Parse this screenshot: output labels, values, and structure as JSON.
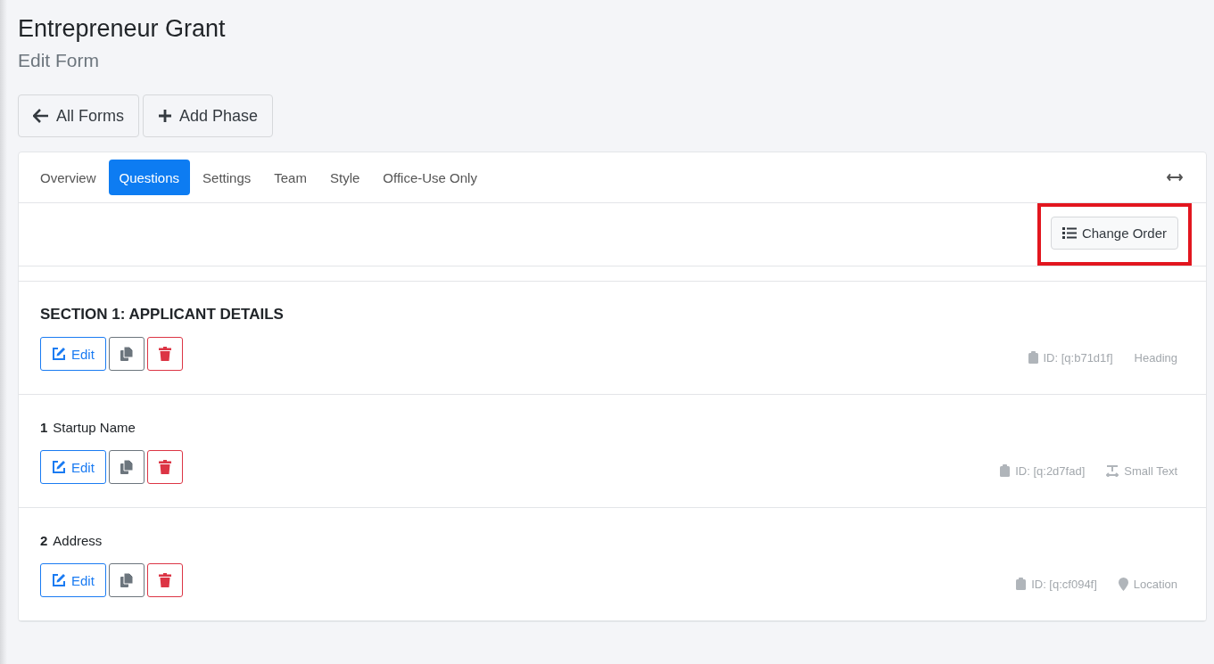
{
  "page": {
    "title": "Entrepreneur Grant",
    "subtitle": "Edit Form"
  },
  "actions": [
    {
      "kind": "back",
      "label": "All Forms"
    },
    {
      "kind": "add",
      "label": "Add Phase"
    }
  ],
  "tabs": [
    {
      "label": "Overview",
      "selected": false
    },
    {
      "label": "Questions",
      "selected": true
    },
    {
      "label": "Settings",
      "selected": false
    },
    {
      "label": "Team",
      "selected": false
    },
    {
      "label": "Style",
      "selected": false
    },
    {
      "label": "Office-Use Only",
      "selected": false
    }
  ],
  "change_order": {
    "label": "Change Order",
    "highlighted": true
  },
  "questions": [
    {
      "kind": "heading",
      "title": "SECTION 1: APPLICANT DETAILS",
      "edit_label": "Edit",
      "id": "ID: [q:b71d1f]",
      "type": "Heading"
    },
    {
      "kind": "small_text",
      "number": "1",
      "title": "Startup Name",
      "edit_label": "Edit",
      "id": "ID: [q:2d7fad]",
      "type": "Small Text"
    },
    {
      "kind": "location",
      "number": "2",
      "title": "Address",
      "edit_label": "Edit",
      "id": "ID: [q:cf094f]",
      "type": "Location"
    }
  ]
}
